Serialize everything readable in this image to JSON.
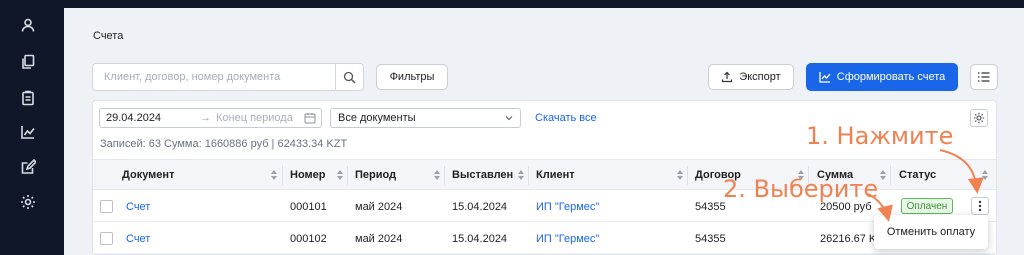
{
  "sidebar": {
    "icons": [
      "user-icon",
      "documents-icon",
      "clipboard-icon",
      "chart-icon",
      "edit-icon",
      "settings-icon"
    ]
  },
  "breadcrumb": "Счета",
  "search": {
    "placeholder": "Клиент, договор, номер документа"
  },
  "toolbar": {
    "filters_label": "Фильтры",
    "export_label": "Экспорт",
    "create_label": "Сформировать счета"
  },
  "filters": {
    "date_from": "29.04.2024",
    "date_to_placeholder": "Конец периода",
    "doc_type": "Все документы",
    "download_all": "Скачать все"
  },
  "summary": "Записей: 63  Сумма: 1660886 руб  |  62433.34 KZT",
  "table": {
    "columns": [
      "Документ",
      "Номер",
      "Период",
      "Выставлен",
      "Клиент",
      "Договор",
      "Сумма",
      "Статус"
    ],
    "rows": [
      {
        "document": "Счет",
        "number": "000101",
        "period": "май 2024",
        "issued": "15.04.2024",
        "client": "ИП \"Гермес\"",
        "contract": "54355",
        "sum": "20500 руб",
        "status": "Оплачен"
      },
      {
        "document": "Счет",
        "number": "000102",
        "period": "май 2024",
        "issued": "15.04.2024",
        "client": "ИП \"Гермес\"",
        "contract": "54355",
        "sum": "26216.67 KZT",
        "status": ""
      }
    ]
  },
  "context_menu": {
    "item": "Отменить оплату"
  },
  "annotations": {
    "step1": "1. Нажмите",
    "step2": "2. Выберите"
  },
  "colors": {
    "accent": "#1a66e8",
    "sidebar": "#0f1729",
    "annotation": "#f08252",
    "paid": "#5cb85c"
  }
}
